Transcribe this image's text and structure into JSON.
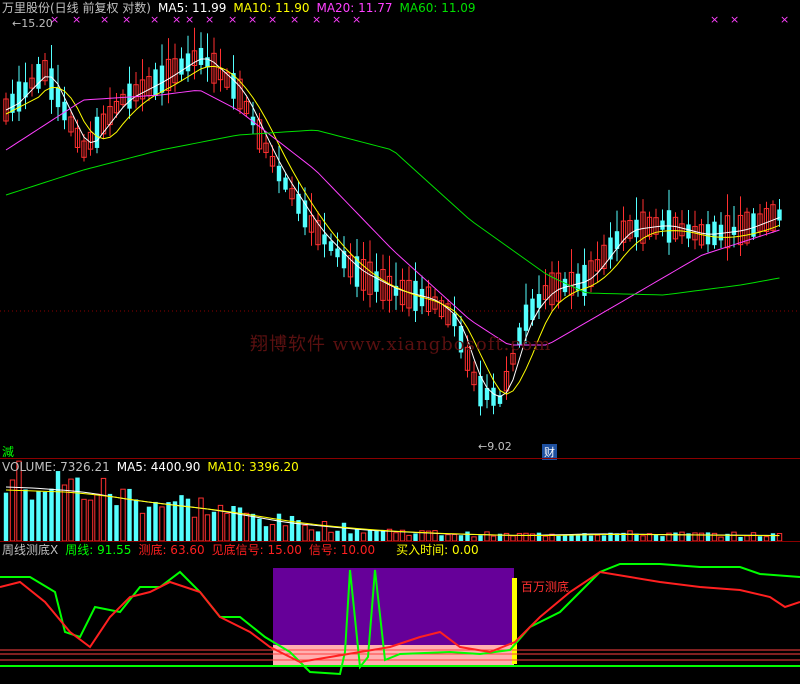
{
  "price_header": {
    "stock": "万里股份(日线 前复权 对数)",
    "ma5": "MA5: 11.99",
    "ma10": "MA10: 11.90",
    "ma20": "MA20: 11.77",
    "ma60": "MA60: 11.09"
  },
  "price_pane": {
    "high_label": "15.20",
    "low_label": "9.02",
    "watermark": "翔博软件 www.xiangbosoft.com",
    "left_tag": "減",
    "finance_flag": "财"
  },
  "volume_header": {
    "volume": "VOLUME: 7326.21",
    "ma5": "MA5: 4400.90",
    "ma10": "MA10: 3396.20"
  },
  "indicator_header": {
    "name": "周线测底X",
    "zx": "周线: 91.55",
    "cd": "测底: 63.60",
    "jd": "见底信号: 15.00",
    "xh": "信号: 10.00",
    "mr": "买入时间: 0.00"
  },
  "indicator_pane": {
    "signal_label": "百万测底"
  },
  "colors": {
    "up": "#ff3030",
    "down": "#54ffff",
    "ma5": "#ffffff",
    "ma10": "#ffff00",
    "ma20": "#ff40ff",
    "ma60": "#00e000",
    "zx": "#00ff00",
    "cd": "#ff2020",
    "zone": "#660099",
    "zone_low": "#ffb0b0",
    "bar": "#ffff00"
  }
}
